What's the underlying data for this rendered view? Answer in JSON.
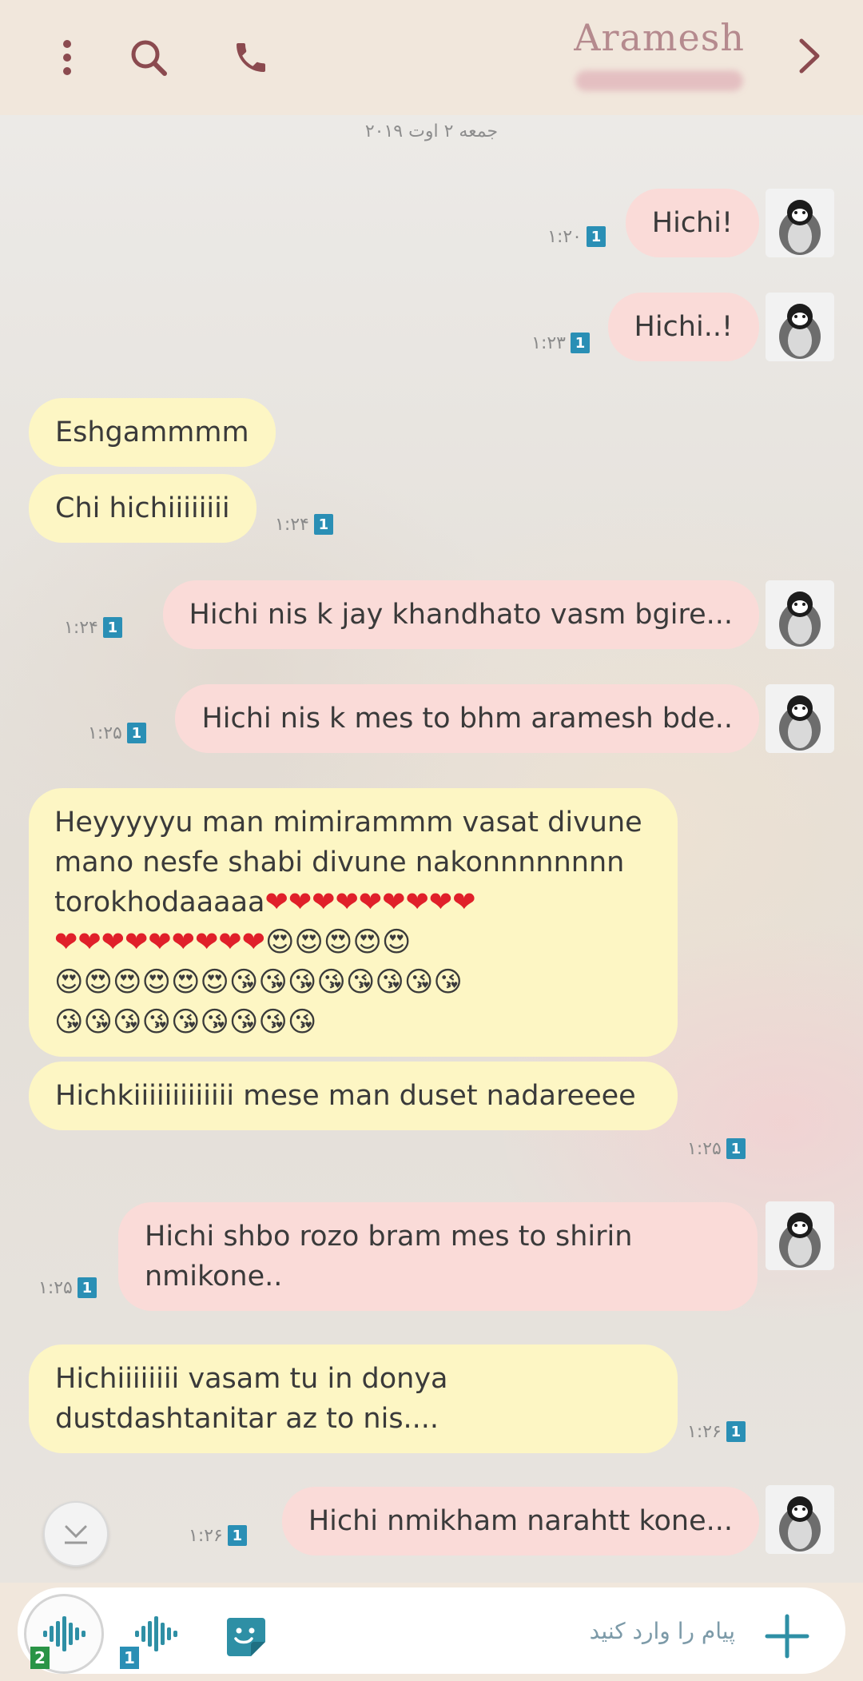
{
  "header": {
    "title": "Aramesh",
    "menu_icon": "more-vertical-icon",
    "search_icon": "search-icon",
    "call_icon": "phone-icon",
    "back_icon": "chevron-right-icon"
  },
  "date_label": "جمعه ۲ اوت ۲۰۱۹",
  "messages": [
    {
      "dir": "out",
      "text": "Hichi!",
      "time": "۱:۲۰",
      "badge": "1"
    },
    {
      "dir": "out",
      "text": "Hichi..!",
      "time": "۱:۲۳",
      "badge": "1"
    },
    {
      "dir": "in",
      "text": "Eshgammmm",
      "time": "",
      "badge": ""
    },
    {
      "dir": "in",
      "text": "Chi hichiiiiiiii",
      "time": "۱:۲۴",
      "badge": "1"
    },
    {
      "dir": "out",
      "text": "Hichi nis k jay khandhato vasm bgire...",
      "time": "۱:۲۴",
      "badge": "1"
    },
    {
      "dir": "out",
      "text": "Hichi nis k mes to bhm aramesh bde..",
      "time": "۱:۲۵",
      "badge": "1"
    },
    {
      "dir": "in",
      "text_line1": "Heyyyyyu man mimirammm vasat divune",
      "text_line2": "mano nesfe shabi divune nakonnnnnnnn",
      "text_line3": "torokhodaaaaa",
      "emoji_hearts": "❤❤❤❤❤❤❤❤❤",
      "emoji_row2_hearts": "❤❤❤❤❤❤❤❤❤",
      "emoji_row2_eyes": "😍😍😍😍😍",
      "emoji_row3": "😍😍😍😍😍😍😘😘😘😘😘😘😘😘",
      "emoji_row4": "😘😘😘😘😘😘😘😘😘"
    },
    {
      "dir": "in",
      "text": "Hichkiiiiiiiiiiiii mese man duset nadareeee",
      "time": "۱:۲۵",
      "badge": "1"
    },
    {
      "dir": "out",
      "text": "Hichi shbo rozo bram mes to shirin nmikone..",
      "time": "۱:۲۵",
      "badge": "1"
    },
    {
      "dir": "in",
      "text": "Hichiiiiiiii vasam tu in donya dustdashtanitar az to nis....",
      "time": "۱:۲۶",
      "badge": "1"
    },
    {
      "dir": "out",
      "text": "Hichi nmikham narahtt kone...",
      "time": "۱:۲۶",
      "badge": "1"
    }
  ],
  "composer": {
    "placeholder": "پیام را وارد کنید",
    "voice_badge_1": "2",
    "voice_badge_2": "1",
    "add_icon": "plus-icon",
    "sticker_icon": "sticker-icon"
  },
  "colors": {
    "header_bg": "#f1e7dc",
    "outgoing_bubble": "#fadbd8",
    "incoming_bubble": "#fdf6c4",
    "badge_blue": "#2a8fb5",
    "accent_teal": "#2e8fa5"
  }
}
